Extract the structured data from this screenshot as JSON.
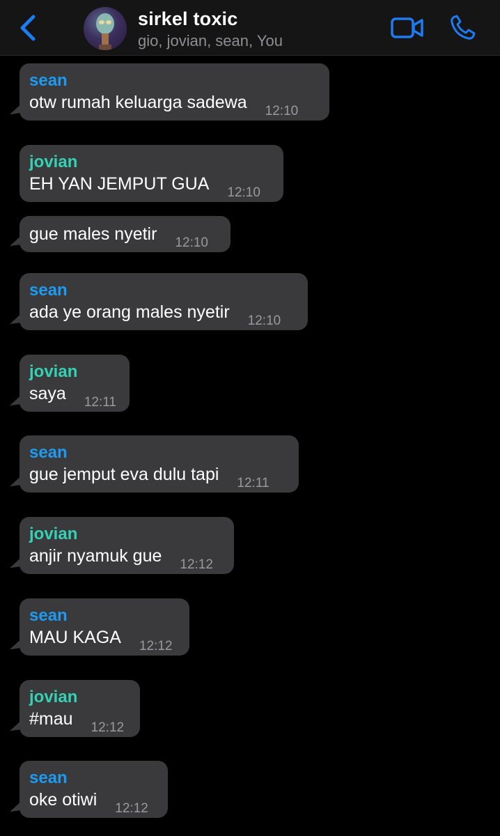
{
  "header": {
    "title": "sirkel toxic",
    "members": "gio, jovian, sean, You"
  },
  "colors": {
    "accent": "#1d9bf0",
    "sean": "#1d9bf0",
    "jovian": "#34d1b4",
    "bubble": "#3a3a3c",
    "background": "#000000"
  },
  "messages": [
    {
      "sender": "sean",
      "text": "otw rumah keluarga sadewa",
      "time": "12:10"
    },
    {
      "sender": "jovian",
      "text": "EH YAN JEMPUT GUA",
      "time": "12:10"
    },
    {
      "sender": "",
      "text": "gue males nyetir",
      "time": "12:10"
    },
    {
      "sender": "sean",
      "text": "ada ye orang males nyetir",
      "time": "12:10"
    },
    {
      "sender": "jovian",
      "text": "saya",
      "time": "12:11"
    },
    {
      "sender": "sean",
      "text": "gue jemput eva dulu tapi",
      "time": "12:11"
    },
    {
      "sender": "jovian",
      "text": "anjir nyamuk gue",
      "time": "12:12"
    },
    {
      "sender": "sean",
      "text": "MAU KAGA",
      "time": "12:12"
    },
    {
      "sender": "jovian",
      "text": "#mau",
      "time": "12:12"
    },
    {
      "sender": "sean",
      "text": "oke otiwi",
      "time": "12:12"
    }
  ]
}
